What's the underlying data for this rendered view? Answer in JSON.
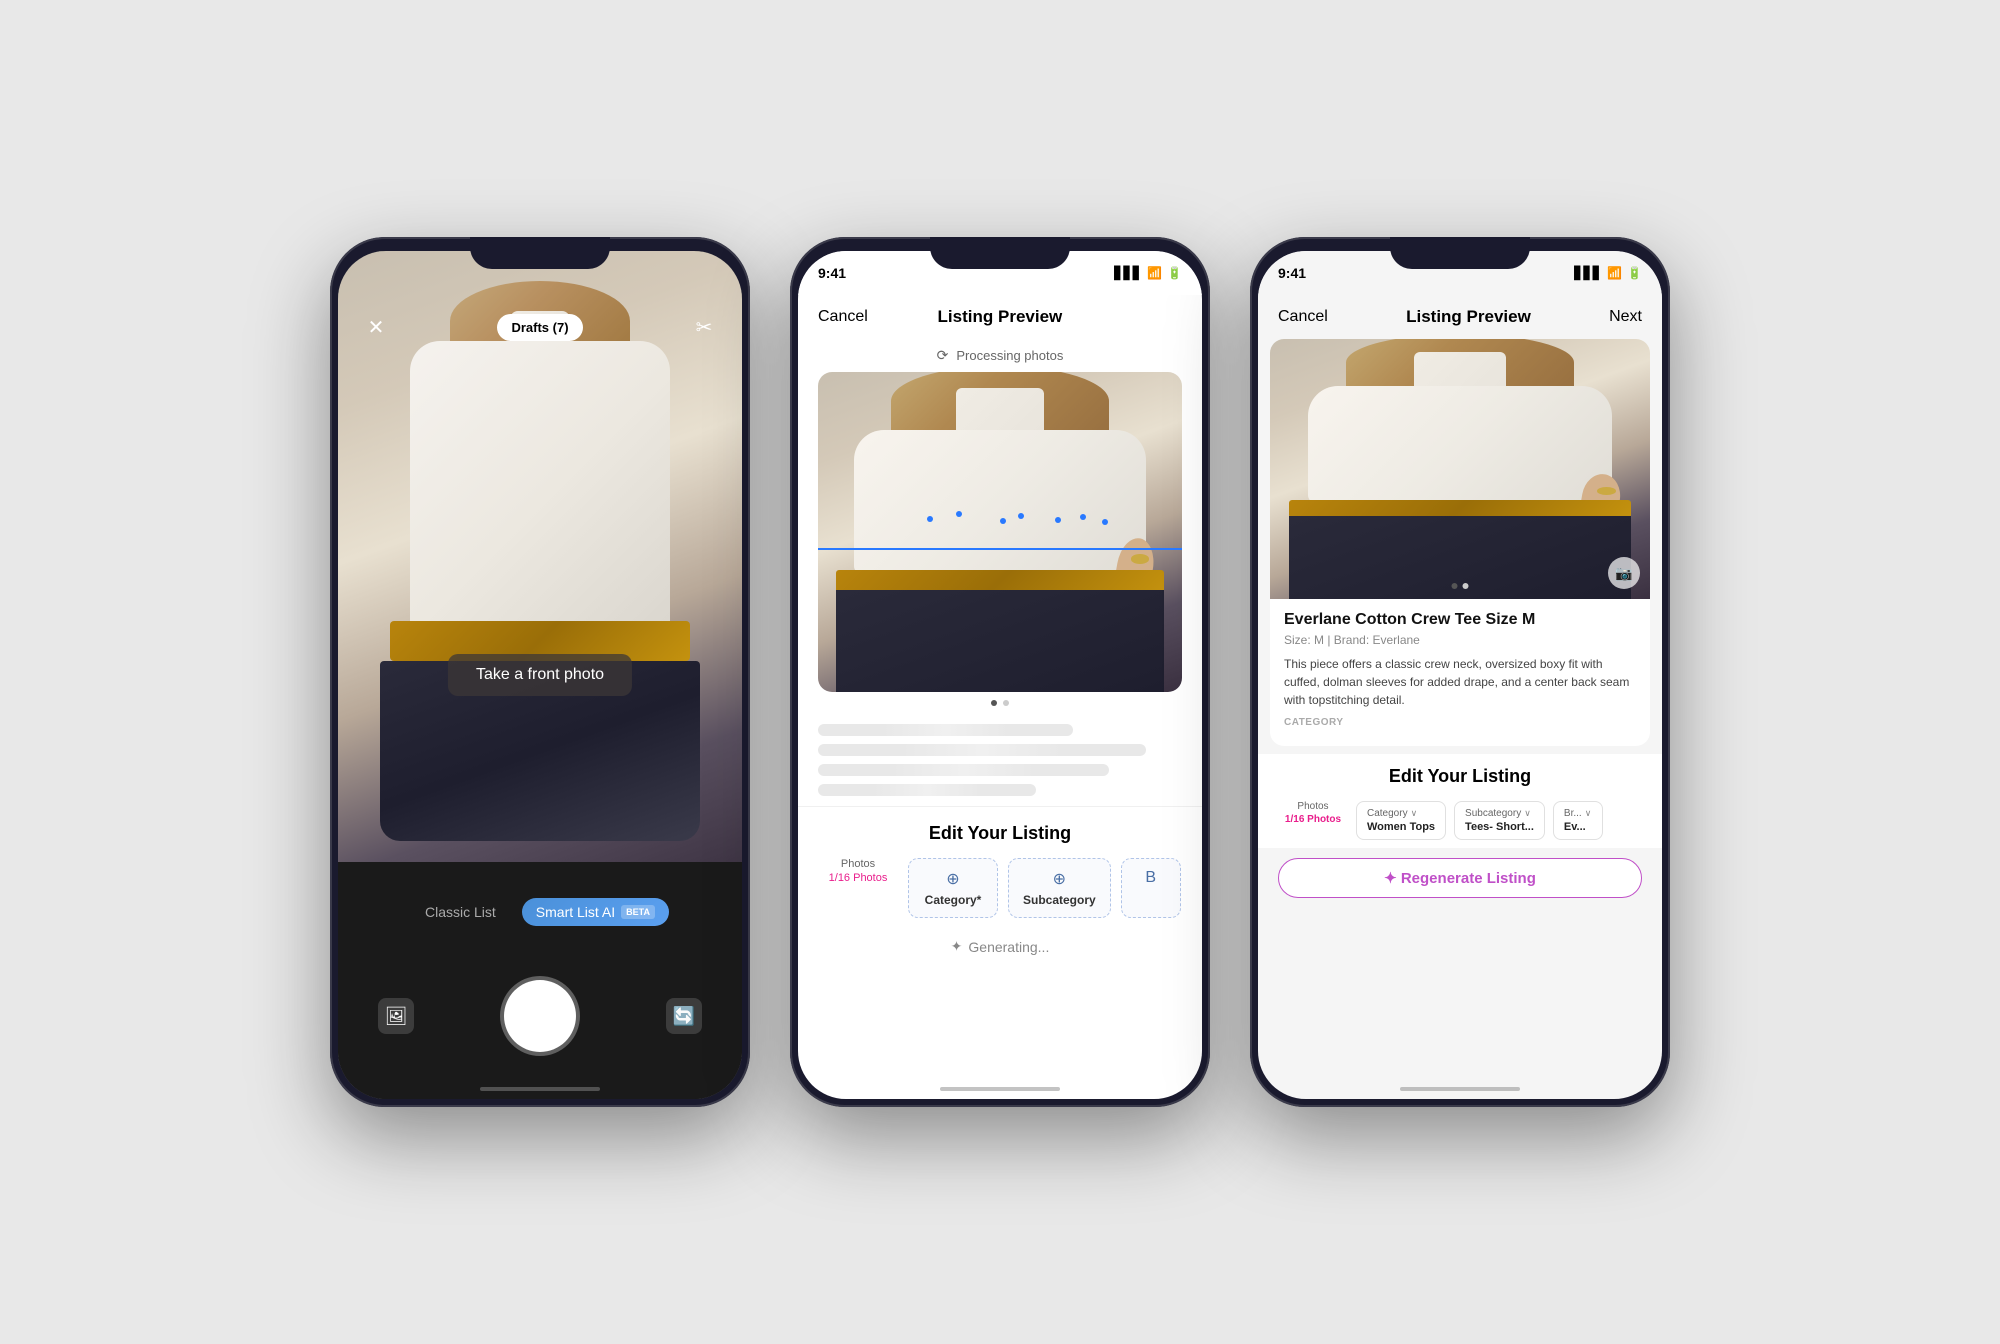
{
  "phone1": {
    "topBar": {
      "closeLabel": "✕",
      "draftsLabel": "Drafts (7)",
      "scissorsLabel": "✂"
    },
    "overlayText": "Take a front photo",
    "modeClassic": "Classic List",
    "modeSmart": "Smart List AI",
    "betaLabel": "BETA",
    "captureHint": "capture"
  },
  "phone2": {
    "statusTime": "9:41",
    "navCancel": "Cancel",
    "navTitle": "Listing Preview",
    "processingText": "Processing photos",
    "editTitle": "Edit Your Listing",
    "tabPhotos": {
      "label": "Photos",
      "value": "1/16 Photos"
    },
    "tabCategory": {
      "label": "Category*"
    },
    "tabSubcategory": {
      "label": "Subcategory"
    },
    "generatingText": "Generating..."
  },
  "phone3": {
    "statusTime": "9:41",
    "navCancel": "Cancel",
    "navTitle": "Listing Preview",
    "navNext": "Next",
    "listingTitle": "Everlane Cotton Crew Tee Size M",
    "listingMeta": "Size: M  |  Brand: Everlane",
    "listingDesc": "This piece offers a classic crew neck, oversized boxy fit with cuffed, dolman sleeves for added drape, and a center back seam with topstitching detail.",
    "categoryLabel": "CATEGORY",
    "editTitle": "Edit Your Listing",
    "tabPhotos": {
      "label": "Photos",
      "value": "1/16 Photos"
    },
    "tabCategory": {
      "label": "Category",
      "value": "Women Tops"
    },
    "tabSubcategory": {
      "label": "Subcategory",
      "value": "Tees- Short..."
    },
    "tabBrand": {
      "label": "Br...",
      "value": "Ev..."
    },
    "regenLabel": "✦  Regenerate Listing"
  }
}
